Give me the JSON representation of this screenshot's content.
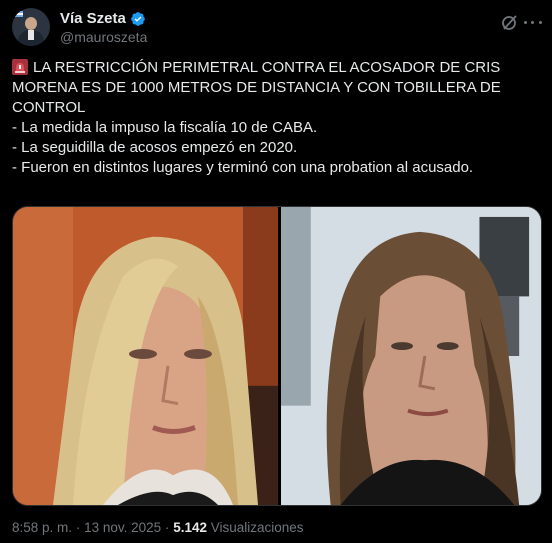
{
  "author": {
    "name": "Vía Szeta",
    "handle": "@mauroszeta",
    "verified": true,
    "avatar_icon": "avatar-man-suit"
  },
  "tweet": {
    "emoji": "rotating-light-emoji",
    "lines": [
      "LA RESTRICCIÓN PERIMETRAL CONTRA EL ACOSADOR DE CRIS",
      "MORENA ES DE 1000 METROS DE DISTANCIA Y CON TOBILLERA DE",
      "CONTROL",
      "- La medida la impuso la fiscalía 10 de CABA.",
      "- La seguidilla de acosos empezó en 2020.",
      "- Fueron en distintos lugares y terminó con una probation al acusado."
    ]
  },
  "media": {
    "left_photo_icon": "photo-woman-blonde",
    "right_photo_icon": "photo-man-long-hair"
  },
  "meta": {
    "time": "8:58 p. m.",
    "separator": "·",
    "date": "13 nov. 2025",
    "views_count": "5.142",
    "views_label": "Visualizaciones"
  },
  "colors": {
    "background": "#000000",
    "text": "#e7e9ea",
    "secondary": "#71767b",
    "verified": "#1d9bf0"
  }
}
